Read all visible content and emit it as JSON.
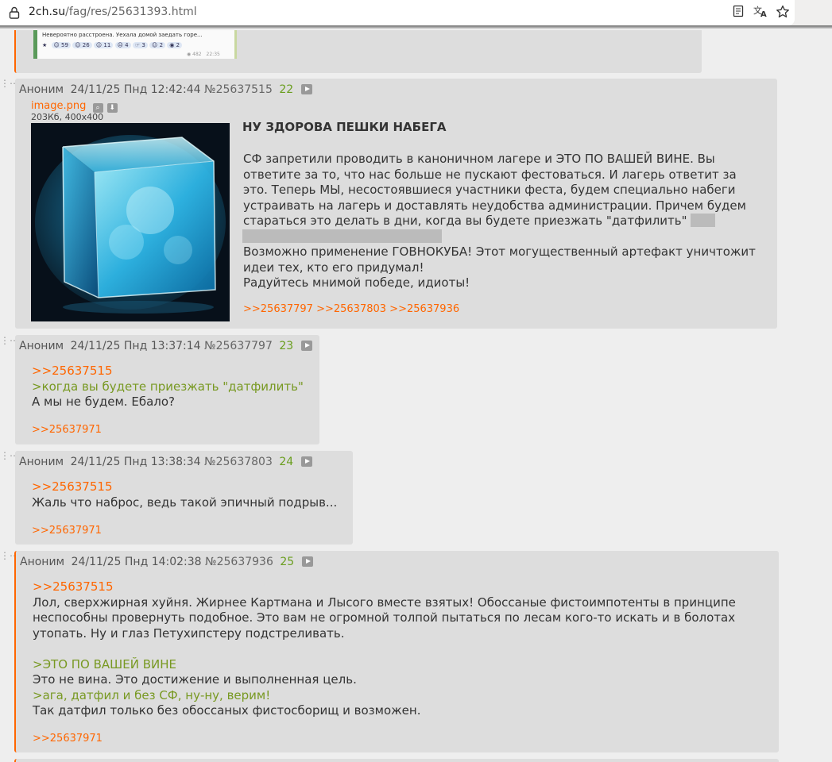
{
  "browser": {
    "url_host": "2ch.su",
    "url_path": "/fag/res/25631393.html"
  },
  "prev_post": {
    "image_text": "Невероятно расстроена. Уехала домой заедать горе...",
    "image_reactions": [
      "59",
      "26",
      "11",
      "4",
      "3",
      "2",
      "2"
    ],
    "image_views": "482",
    "image_time": "22:35"
  },
  "posts": [
    {
      "author": "Аноним",
      "date": "24/11/25 Пнд 12:42:44",
      "number": "№25637515",
      "count": "22",
      "file_name": "image.png",
      "file_meta": "203Кб, 400x400",
      "title": "НУ ЗДОРОВА ПЕШКИ НАБЕГА",
      "lines": [
        "СФ запретили проводить в каноничном лагере и ЭТО ПО ВАШЕЙ ВИНЕ. Вы",
        "ответите за то, что нас больше не пускают фестоваться. И лагерь ответит за",
        "это. Теперь МЫ, несостоявшиеся участники феста, будем специально набеги",
        "устраивать на лагерь и доставлять неудобства администрации. Причем будем",
        "стараться это делать в дни, когда вы будете приезжать \"датфилить\"",
        "Возможно применение ГОВНОКУБА! Этот могущественный артефакт уничтожит",
        "идеи тех, кто его придумал!",
        "Радуйтесь мнимой победе, идиоты!"
      ],
      "replies": ">>25637797 >>25637803 >>25637936"
    },
    {
      "author": "Аноним",
      "date": "24/11/25 Пнд 13:37:14",
      "number": "№25637797",
      "count": "23",
      "reply_to": ">>25637515",
      "quote": ">когда вы будете приезжать \"датфилить\"",
      "line": "А мы не будем. Ебало?",
      "replies": ">>25637971"
    },
    {
      "author": "Аноним",
      "date": "24/11/25 Пнд 13:38:34",
      "number": "№25637803",
      "count": "24",
      "reply_to": ">>25637515",
      "line": "Жаль что наброс, ведь такой эпичный подрыв...",
      "replies": ">>25637971"
    },
    {
      "author": "Аноним",
      "date": "24/11/25 Пнд 14:02:38",
      "number": "№25637936",
      "count": "25",
      "reply_to": ">>25637515",
      "lines": [
        "Лол, сверхжирная хуйня. Жирнее Картмана и Лысого вместе взятых! Обоссаные фистоимпотенты в принципе",
        "неспособны провернуть подобное. Это вам не огромной толпой пытаться по лесам кого-то искать и в болотах",
        "утопать. Ну и глаз Петухипстеру подстреливать."
      ],
      "quote1": ">ЭТО ПО ВАШЕЙ ВИНЕ",
      "line2": "Это не вина. Это достижение и выполненная цель.",
      "quote2": ">ага, датфил и без СФ, ну-ну, верим!",
      "line3": "Так датфил только без обоссаных фистосборищ и возможен.",
      "replies": ">>25637971"
    }
  ],
  "colors": {
    "accent": "#ff6600",
    "quote": "#789922",
    "post_bg": "#dddddd",
    "page_bg": "#eeeeee"
  }
}
